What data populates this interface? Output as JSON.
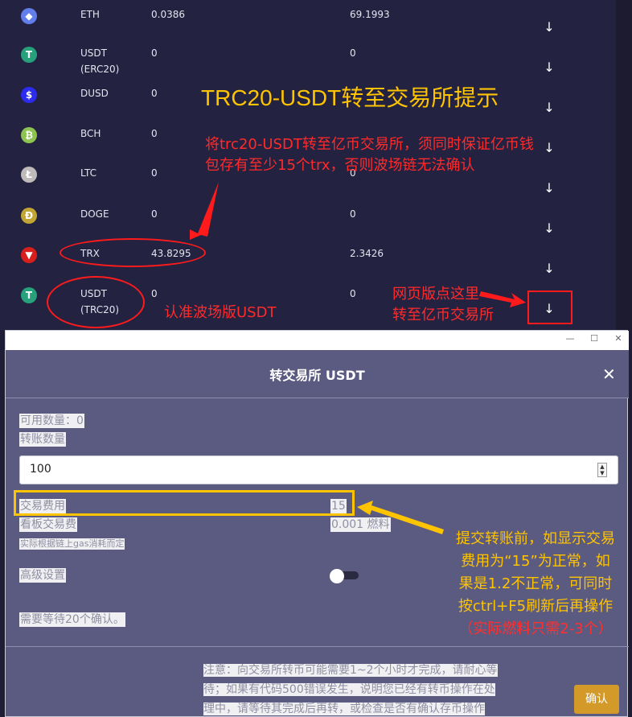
{
  "coins": [
    {
      "name": "ETH",
      "name2": "",
      "balance": "0.0386",
      "value": "69.1993",
      "icon": "eth-icon",
      "color": "#627eea",
      "glyph": "◆"
    },
    {
      "name": "USDT",
      "name2": "(ERC20)",
      "balance": "0",
      "value": "0",
      "icon": "tether-icon",
      "color": "#26a17b",
      "glyph": "T"
    },
    {
      "name": "DUSD",
      "name2": "",
      "balance": "0",
      "value": "",
      "icon": "dollar-icon",
      "color": "#2c2cf0",
      "glyph": "$"
    },
    {
      "name": "BCH",
      "name2": "",
      "balance": "0",
      "value": "",
      "icon": "bitcoin-cash-icon",
      "color": "#8dc351",
      "glyph": "₿"
    },
    {
      "name": "LTC",
      "name2": "",
      "balance": "0",
      "value": "0",
      "icon": "litecoin-icon",
      "color": "#bfbbbb",
      "glyph": "Ł"
    },
    {
      "name": "DOGE",
      "name2": "",
      "balance": "0",
      "value": "0",
      "icon": "dogecoin-icon",
      "color": "#c2a633",
      "glyph": "Ð"
    },
    {
      "name": "TRX",
      "name2": "",
      "balance": "43.8295",
      "value": "2.3426",
      "icon": "tron-icon",
      "color": "#d7201c",
      "glyph": "▼"
    },
    {
      "name": "USDT",
      "name2": "(TRC20)",
      "balance": "0",
      "value": "0",
      "icon": "tether-icon",
      "color": "#26a17b",
      "glyph": "T"
    }
  ],
  "arrow_glyph": "↓",
  "annotations": {
    "title": "TRC20-USDT转至交易所提示",
    "warning_line1": "将trc20-USDT转至亿币交易所，须同时保证亿币钱",
    "warning_line2": "包存有至少15个trx，否则波场链无法确认",
    "trc20_note": "认准波场版USDT",
    "click_line1": "网页版点这里",
    "click_line2": "转至亿币交易所",
    "fee_line1": "提交转账前，如显示交易",
    "fee_line2": "费用为“15”为正常，如",
    "fee_line3": "果是1.2不正常，可同时",
    "fee_line4": "按ctrl+F5刷新后再操作",
    "fee_line5": "（实际燃料只需2-3个）"
  },
  "modal": {
    "window_minimize": "—",
    "window_maximize": "☐",
    "window_close": "✕",
    "title": "转交易所 USDT",
    "close_glyph": "✕",
    "available": "可用数量：0",
    "transfer_amount_label": "转账数量",
    "amount_value": "100",
    "fee_label": "交易费用",
    "fee_value": "15",
    "board_fee_label": "看板交易费",
    "board_fee_value": "0.001 燃料",
    "gas_note": "实际根据链上gas消耗而定",
    "advanced": "高级设置",
    "confirmations": "需要等待20个确认。",
    "notice_line1": "注意：向交易所转币可能需要1~2个小时才完成，请耐心等",
    "notice_line2": "待；如果有代码500错误发生，说明您已经有转币操作在处",
    "notice_line3": "理中，请等待其完成后再转，或检查是否有确认存币操作",
    "confirm_button": "确认"
  }
}
